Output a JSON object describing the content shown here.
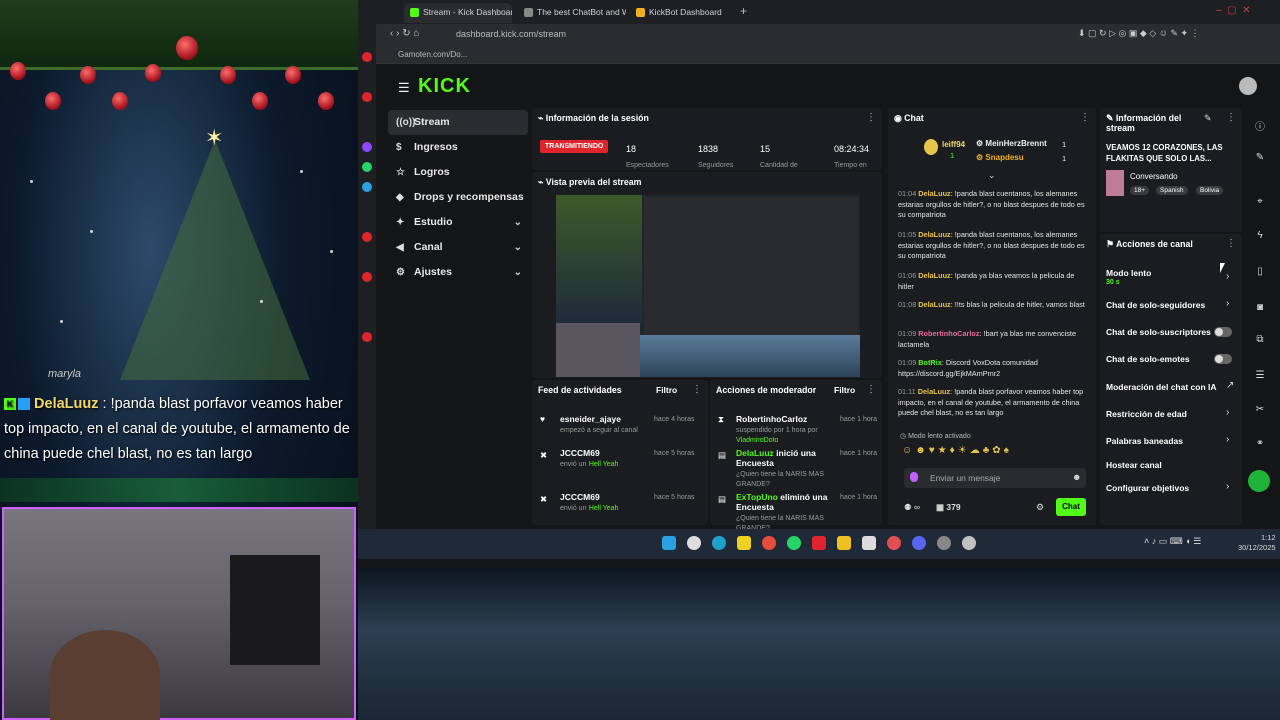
{
  "overlay": {
    "watermark": "maryla",
    "chat_user": "DelaLuuz",
    "chat_sep": " : ",
    "chat_text": "!panda blast porfavor veamos haber top impacto, en el canal de youtube, el armamento de china puede chel blast, no es tan largo"
  },
  "browser": {
    "tabs": [
      {
        "label": "Stream - Kick Dashboard",
        "color": "#53fc18"
      },
      {
        "label": "The best ChatBot and Wi",
        "color": "#888888"
      },
      {
        "label": "KickBot Dashboard",
        "color": "#f0b020"
      }
    ],
    "url": "dashboard.kick.com/stream",
    "bookmark": "Gamoten.com/Do..."
  },
  "kick": {
    "logo": "KICK",
    "nav": [
      {
        "label": "Stream",
        "icon": "((o))",
        "chev": ""
      },
      {
        "label": "Ingresos",
        "icon": "$",
        "chev": ""
      },
      {
        "label": "Logros",
        "icon": "☆",
        "chev": ""
      },
      {
        "label": "Drops y recompensas",
        "icon": "◆",
        "chev": ""
      },
      {
        "label": "Estudio",
        "icon": "✦",
        "chev": "⌄"
      },
      {
        "label": "Canal",
        "icon": "◀",
        "chev": "⌄"
      },
      {
        "label": "Ajustes",
        "icon": "⚙",
        "chev": "⌄"
      }
    ],
    "session": {
      "title": "Información de la sesión",
      "live": "TRANSMITIENDO",
      "stats": [
        {
          "value": "18",
          "label": "Espectadores"
        },
        {
          "value": "1838",
          "label": "Seguidores"
        },
        {
          "value": "15",
          "label": "Cantidad de"
        },
        {
          "value": "08:24:34",
          "label": "Tiempo en"
        }
      ]
    },
    "preview": {
      "title": "Vista previa del stream"
    },
    "feed": {
      "title": "Feed de actividades",
      "filter": "Filtro",
      "items": [
        {
          "user": "esneider_ajaye",
          "action": "empezó a seguir al canal",
          "time": "hace 4 horas"
        },
        {
          "user": "JCCCM69",
          "action": "envió un",
          "gift": "Hell Yeah",
          "time": "hace 5 horas"
        },
        {
          "user": "JCCCM69",
          "action": "envió un",
          "gift": "Hell Yeah",
          "time": "hace 5 horas"
        }
      ]
    },
    "mod": {
      "title": "Acciones de moderador",
      "filter": "Filtro",
      "items": [
        {
          "user": "RobertinhoCarloz",
          "desc": "suspendido por 1 hora por",
          "by": "VladmiroDoto",
          "time": "hace 1 hora"
        },
        {
          "user": "DelaLuuz",
          "verb": "inició una Encuesta",
          "desc": "¿Quien tiene la NARIS MAS GRANDE?",
          "time": "hace 1 hora"
        },
        {
          "user": "ExTopUno",
          "verb": "eliminó una Encuesta",
          "desc": "¿Quien tiene la NARIS MAS GRANDE?",
          "time": "hace 1 hora"
        }
      ]
    },
    "chat": {
      "title": "Chat",
      "top": [
        {
          "name": "leiff94",
          "count": "1"
        },
        {
          "name": "MeinHerzBrennt",
          "count": "1"
        },
        {
          "name": "Snapdesu",
          "count": "1"
        }
      ],
      "messages": [
        {
          "time": "01:04",
          "user": "DelaLuuz",
          "color": "#e8c44a",
          "text": "!panda blast cuentanos, los alemanes estarias orgullos de hitler?, o no blast despues de todo es su compatriota"
        },
        {
          "time": "01:05",
          "user": "DelaLuuz",
          "color": "#e8c44a",
          "text": "!panda blast cuentanos, los alemanes estarias orgullos de hitler?, o no blast despues de todo es su compatriota"
        },
        {
          "time": "01:06",
          "user": "DelaLuuz",
          "color": "#e8c44a",
          "text": "!panda ya blas veamos la pelicula de hitler"
        },
        {
          "time": "01:08",
          "user": "DelaLuuz",
          "color": "#e8c44a",
          "text": "!!ts blas la pelicula de hitler, vamos blast"
        },
        {
          "time": "01:09",
          "user": "RobertinhoCarloz",
          "color": "#e86a9a",
          "text": "!bart ya blas me convenciste lactamela"
        },
        {
          "time": "01:09",
          "user": "BotRix",
          "color": "#53fc18",
          "text": "Discord VoxDota comunidad https://discord.gg/EjkMAmPmr2"
        },
        {
          "time": "01:11",
          "user": "DelaLuuz",
          "color": "#e8c44a",
          "text": "!panda blast porfavor veamos haber top impacto, en el canal de youtube, el armamento de china puede chel blast, no es tan largo"
        }
      ],
      "slow_mode": "Modo lento activado",
      "placeholder": "Enviar un mensaje",
      "viewers": "379",
      "send": "Chat"
    },
    "stream_info": {
      "title": "Información del stream",
      "stream_title": "VEAMOS 12 CORAZONES, LAS FLAKITAS QUE SOLO LAS...",
      "category": "Conversando",
      "tags": [
        "18+",
        "Spanish",
        "Bolivia"
      ]
    },
    "channel_actions": {
      "title": "Acciones de canal",
      "slow_mode": "Modo lento",
      "slow_value": "30 s",
      "items": [
        "Chat de solo-seguidores",
        "Chat de solo-suscriptores",
        "Chat de solo-emotes",
        "Moderación del chat con IA",
        "Restricción de edad",
        "Palabras baneadas",
        "Hostear canal",
        "Configurar objetivos"
      ]
    }
  },
  "taskbar": {
    "time": "1:12",
    "date": "30/12/2025"
  }
}
